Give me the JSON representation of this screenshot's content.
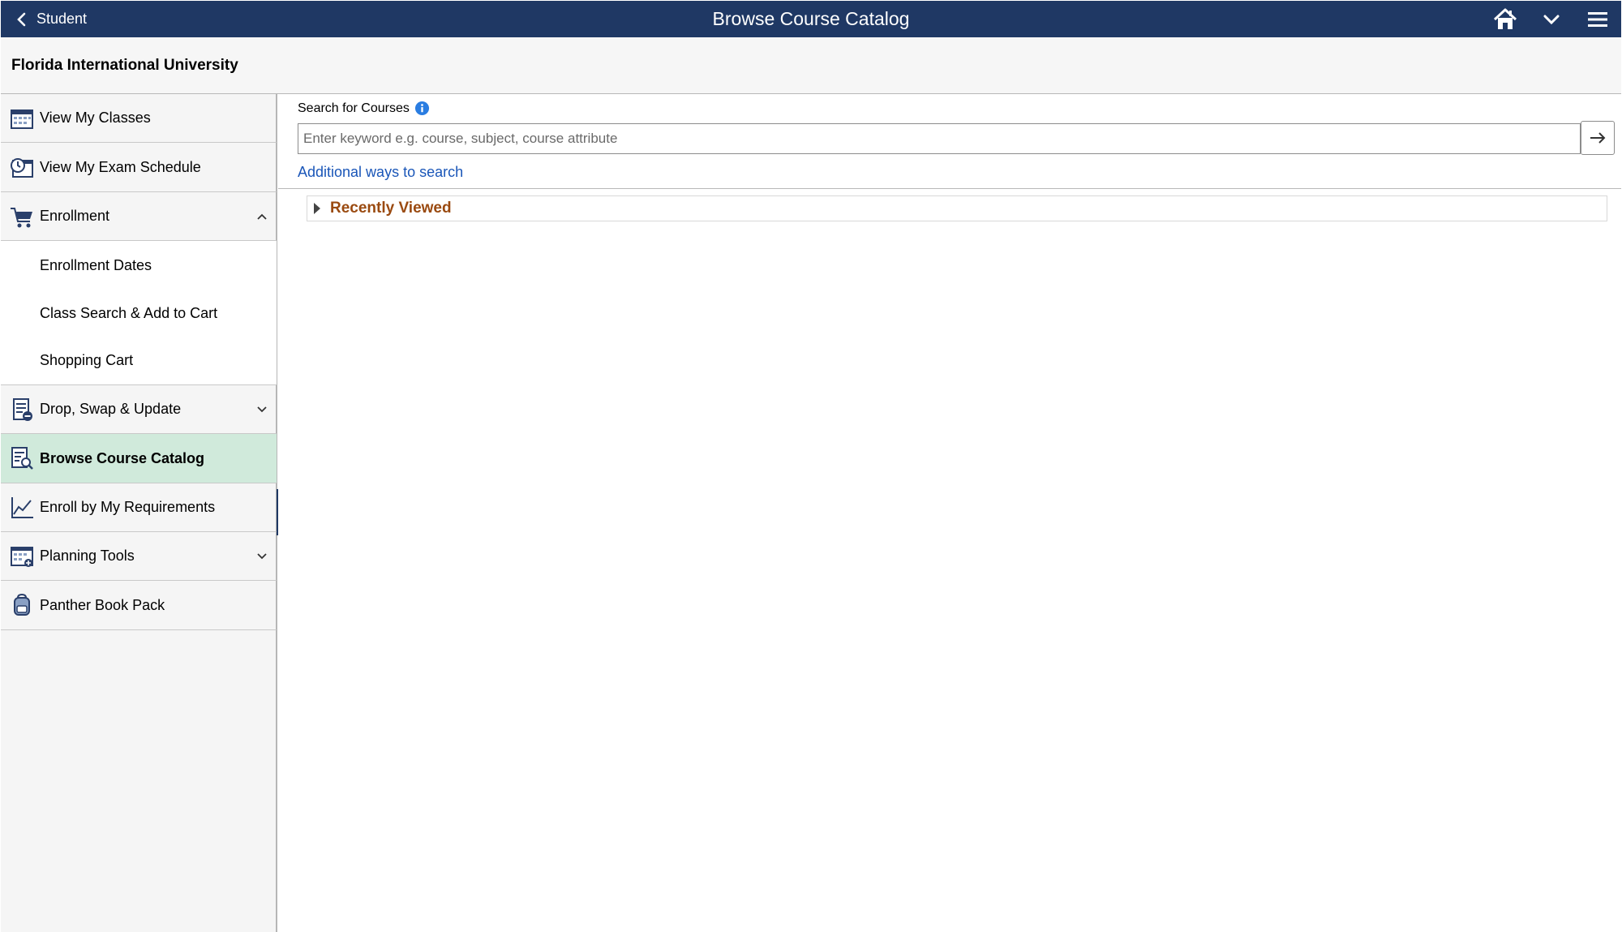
{
  "header": {
    "back_label": "Student",
    "title": "Browse Course Catalog",
    "icons": [
      "home-icon",
      "chevron-down-icon",
      "hamburger-menu-icon"
    ]
  },
  "org": {
    "name": "Florida International University"
  },
  "sidebar": {
    "items": [
      {
        "label": "View My Classes",
        "icon": "calendar-icon"
      },
      {
        "label": "View My Exam Schedule",
        "icon": "clock-calendar-icon"
      },
      {
        "label": "Enrollment",
        "icon": "shopping-cart-icon",
        "expanded": true
      },
      {
        "label": "Enrollment Dates"
      },
      {
        "label": "Class Search & Add to Cart"
      },
      {
        "label": "Shopping Cart"
      },
      {
        "label": "Drop, Swap & Update",
        "icon": "document-minus-icon",
        "expanded": false
      },
      {
        "label": "Browse Course Catalog",
        "icon": "catalog-search-icon",
        "active": true
      },
      {
        "label": "Enroll by My Requirements",
        "icon": "line-chart-icon"
      },
      {
        "label": "Planning Tools",
        "icon": "planner-icon",
        "expanded": false
      },
      {
        "label": "Panther Book Pack",
        "icon": "backpack-icon"
      }
    ],
    "active_color": "#d0eadb"
  },
  "search": {
    "label": "Search for Courses",
    "placeholder": "Enter keyword e.g. course, subject, course attribute",
    "value": "",
    "additional_link": "Additional ways to search"
  },
  "recently_viewed": {
    "label": "Recently Viewed",
    "expanded": false
  },
  "colors": {
    "header_bg": "#1f3864",
    "link": "#1a56b8",
    "section_title": "#9a4a10"
  }
}
